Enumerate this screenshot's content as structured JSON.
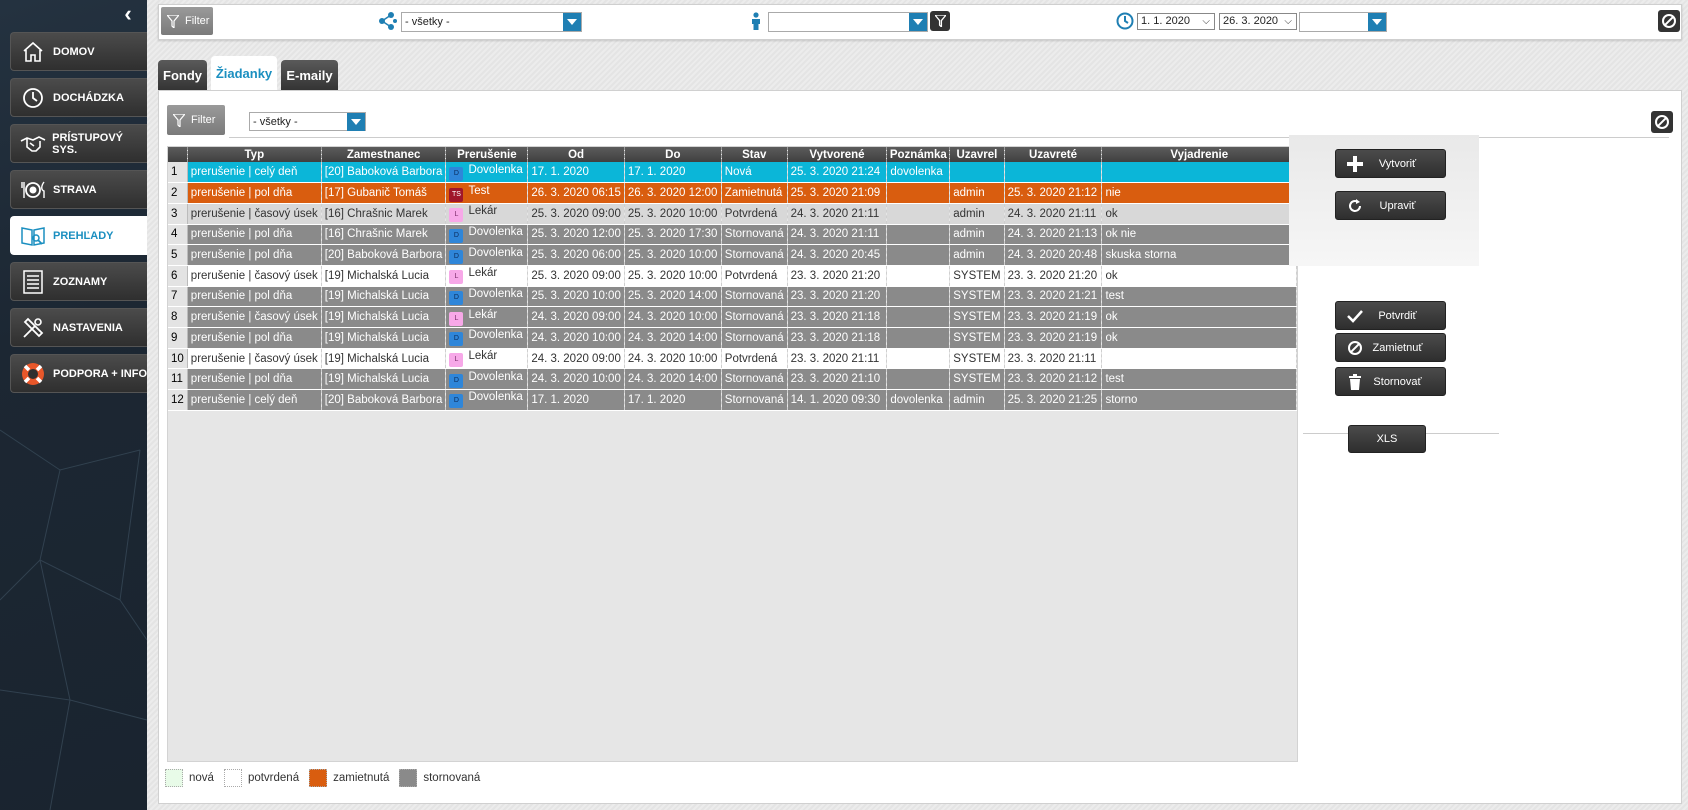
{
  "sidebar": {
    "items": [
      {
        "label": "DOMOV",
        "icon": "home-icon"
      },
      {
        "label": "DOCHÁDZKA",
        "icon": "clock-icon"
      },
      {
        "label": "PRÍSTUPOVÝ SYS.",
        "icon": "handshake-icon"
      },
      {
        "label": "STRAVA",
        "icon": "plate-icon"
      },
      {
        "label": "PREHĽADY",
        "icon": "reports-icon",
        "active": true
      },
      {
        "label": "ZOZNAMY",
        "icon": "list-icon"
      },
      {
        "label": "NASTAVENIA",
        "icon": "tools-icon"
      },
      {
        "label": "PODPORA + INFO",
        "icon": "lifebuoy-icon"
      }
    ]
  },
  "topbar": {
    "filter_label": "Filter",
    "group_select": "- všetky -",
    "person_select": "",
    "date_from": "1. 1. 2020",
    "date_to": "26. 3. 2020",
    "period_select": ""
  },
  "tabs": [
    {
      "label": "Fondy"
    },
    {
      "label": "Žiadanky",
      "active": true
    },
    {
      "label": "E-maily"
    }
  ],
  "panel": {
    "filter_label": "Filter",
    "status_select": "- všetky -"
  },
  "table": {
    "columns": [
      "Typ",
      "Zamestnanec",
      "Prerušenie",
      "Od",
      "Do",
      "Stav",
      "Vytvorené",
      "Poznámka",
      "Uzavrel",
      "Uzavreté",
      "Vyjadrenie"
    ],
    "rows": [
      {
        "n": "1",
        "typ": "prerušenie | celý deň",
        "zam": "[20] Baboková Barbora",
        "badge": "D",
        "prer": "Dovolenka",
        "od": "17. 1. 2020",
        "do": "17. 1. 2020",
        "stav": "Nová",
        "vytv": "25. 3. 2020  21:24",
        "pozn": "dovolenka",
        "uzavrel": "",
        "uzavrete": "",
        "vyj": "",
        "style": "nova"
      },
      {
        "n": "2",
        "typ": "prerušenie | pol dňa",
        "zam": "[17] Gubanič Tomáš",
        "badge": "TS",
        "prer": "Test",
        "od": "26. 3. 2020 06:15",
        "do": "26. 3. 2020 12:00",
        "stav": "Zamietnutá",
        "vytv": "25. 3. 2020  21:09",
        "pozn": "",
        "uzavrel": "admin",
        "uzavrete": "25. 3. 2020  21:12",
        "vyj": "nie",
        "style": "zam"
      },
      {
        "n": "3",
        "typ": "prerušenie | časový úsek",
        "zam": "[16] Chrašnic Marek",
        "badge": "L",
        "prer": "Lekár",
        "od": "25. 3. 2020 09:00",
        "do": "25. 3. 2020 10:00",
        "stav": "Potvrdená",
        "vytv": "24. 3. 2020  21:11",
        "pozn": "",
        "uzavrel": "admin",
        "uzavrete": "24. 3. 2020  21:11",
        "vyj": "ok",
        "style": "lite"
      },
      {
        "n": "4",
        "typ": "prerušenie | pol dňa",
        "zam": "[16] Chrašnic Marek",
        "badge": "D",
        "prer": "Dovolenka",
        "od": "25. 3. 2020 12:00",
        "do": "25. 3. 2020 17:30",
        "stav": "Stornovaná",
        "vytv": "24. 3. 2020  21:11",
        "pozn": "",
        "uzavrel": "admin",
        "uzavrete": "24. 3. 2020  21:13",
        "vyj": "ok nie",
        "style": "sto"
      },
      {
        "n": "5",
        "typ": "prerušenie | pol dňa",
        "zam": "[20] Baboková Barbora",
        "badge": "D",
        "prer": "Dovolenka",
        "od": "25. 3. 2020 06:00",
        "do": "25. 3. 2020 10:00",
        "stav": "Stornovaná",
        "vytv": "24. 3. 2020  20:45",
        "pozn": "",
        "uzavrel": "admin",
        "uzavrete": "24. 3. 2020  20:48",
        "vyj": "skuska storna",
        "style": "sto"
      },
      {
        "n": "6",
        "typ": "prerušenie | časový úsek",
        "zam": "[19] Michalská Lucia",
        "badge": "L",
        "prer": "Lekár",
        "od": "25. 3. 2020 09:00",
        "do": "25. 3. 2020 10:00",
        "stav": "Potvrdená",
        "vytv": "23. 3. 2020  21:20",
        "pozn": "",
        "uzavrel": "SYSTEM",
        "uzavrete": "23. 3. 2020  21:20",
        "vyj": "ok",
        "style": "pot"
      },
      {
        "n": "7",
        "typ": "prerušenie | pol dňa",
        "zam": "[19] Michalská Lucia",
        "badge": "D",
        "prer": "Dovolenka",
        "od": "25. 3. 2020 10:00",
        "do": "25. 3. 2020 14:00",
        "stav": "Stornovaná",
        "vytv": "23. 3. 2020  21:20",
        "pozn": "",
        "uzavrel": "SYSTEM",
        "uzavrete": "23. 3. 2020  21:21",
        "vyj": "test",
        "style": "sto"
      },
      {
        "n": "8",
        "typ": "prerušenie | časový úsek",
        "zam": "[19] Michalská Lucia",
        "badge": "L",
        "prer": "Lekár",
        "od": "24. 3. 2020 09:00",
        "do": "24. 3. 2020 10:00",
        "stav": "Stornovaná",
        "vytv": "23. 3. 2020  21:18",
        "pozn": "",
        "uzavrel": "SYSTEM",
        "uzavrete": "23. 3. 2020  21:19",
        "vyj": "ok",
        "style": "sto"
      },
      {
        "n": "9",
        "typ": "prerušenie | pol dňa",
        "zam": "[19] Michalská Lucia",
        "badge": "D",
        "prer": "Dovolenka",
        "od": "24. 3. 2020 10:00",
        "do": "24. 3. 2020 14:00",
        "stav": "Stornovaná",
        "vytv": "23. 3. 2020  21:18",
        "pozn": "",
        "uzavrel": "SYSTEM",
        "uzavrete": "23. 3. 2020  21:19",
        "vyj": "ok",
        "style": "sto"
      },
      {
        "n": "10",
        "typ": "prerušenie | časový úsek",
        "zam": "[19] Michalská Lucia",
        "badge": "L",
        "prer": "Lekár",
        "od": "24. 3. 2020 09:00",
        "do": "24. 3. 2020 10:00",
        "stav": "Potvrdená",
        "vytv": "23. 3. 2020  21:11",
        "pozn": "",
        "uzavrel": "SYSTEM",
        "uzavrete": "23. 3. 2020  21:11",
        "vyj": "",
        "style": "pot"
      },
      {
        "n": "11",
        "typ": "prerušenie | pol dňa",
        "zam": "[19] Michalská Lucia",
        "badge": "D",
        "prer": "Dovolenka",
        "od": "24. 3. 2020 10:00",
        "do": "24. 3. 2020 14:00",
        "stav": "Stornovaná",
        "vytv": "23. 3. 2020  21:10",
        "pozn": "",
        "uzavrel": "SYSTEM",
        "uzavrete": "23. 3. 2020  21:12",
        "vyj": "test",
        "style": "sto"
      },
      {
        "n": "12",
        "typ": "prerušenie | celý deň",
        "zam": "[20] Baboková Barbora",
        "badge": "D",
        "prer": "Dovolenka",
        "od": "17. 1. 2020",
        "do": "17. 1. 2020",
        "stav": "Stornovaná",
        "vytv": "14. 1. 2020  09:30",
        "pozn": "dovolenka",
        "uzavrel": "admin",
        "uzavrete": "25. 3. 2020  21:25",
        "vyj": "storno",
        "style": "sto"
      }
    ]
  },
  "actions": {
    "create": "Vytvoriť",
    "edit": "Upraviť",
    "confirm": "Potvrdiť",
    "reject": "Zamietnuť",
    "cancel": "Stornovať",
    "xls": "XLS"
  },
  "legend": [
    {
      "label": "nová",
      "color": "#e8fbe8"
    },
    {
      "label": "potvrdená",
      "color": "#ffffff"
    },
    {
      "label": "zamietnutá",
      "color": "#d95d0f"
    },
    {
      "label": "stornovaná",
      "color": "#8a8a8a"
    }
  ],
  "colors": {
    "accent": "#1b8fc0",
    "nova": "#0bb6d8",
    "zamietnuta": "#d95d0f",
    "stornovana": "#8a8a8a"
  }
}
